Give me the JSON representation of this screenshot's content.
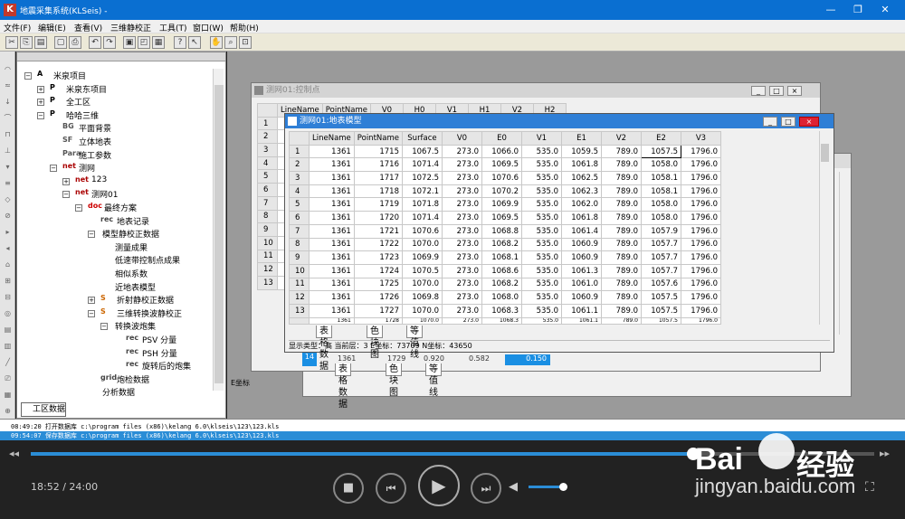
{
  "app": {
    "title": "地震采集系统(KLSeis) -"
  },
  "window_controls": {
    "min": "—",
    "max": "❐",
    "close": "✕"
  },
  "menu": [
    "文件(F)",
    "编辑(E)",
    "查看(V)",
    "三维静校正",
    "工具(T)",
    "窗口(W)",
    "帮助(H)"
  ],
  "toolbar": {
    "icons": [
      "cut-icon",
      "copy-icon",
      "paste-icon",
      "print-preview-icon",
      "print-icon",
      "undo-icon",
      "redo-icon",
      "window-icon",
      "chart-icon",
      "table-icon",
      "help-icon",
      "context-help-icon",
      "hand-icon",
      "zoom-icon",
      "fit-icon"
    ]
  },
  "tree": {
    "items": [
      {
        "label": "米泉项目",
        "icon": "A",
        "depth": 0,
        "expander": "−"
      },
      {
        "label": "米泉东项目",
        "icon": "P",
        "depth": 1,
        "expander": "+"
      },
      {
        "label": "全工区",
        "icon": "P",
        "depth": 1,
        "expander": "+"
      },
      {
        "label": "哈哈三维",
        "icon": "P",
        "depth": 1,
        "expander": "−"
      },
      {
        "label": "平面背景",
        "icon": "BG",
        "depth": 2,
        "expander": ""
      },
      {
        "label": "立体地表",
        "icon": "SF",
        "depth": 2,
        "expander": ""
      },
      {
        "label": "施工参数",
        "icon": "Para",
        "depth": 2,
        "expander": ""
      },
      {
        "label": "测网",
        "icon": "net",
        "depth": 2,
        "expander": "−"
      },
      {
        "label": "123",
        "icon": "net",
        "depth": 3,
        "expander": "+"
      },
      {
        "label": "测网01",
        "icon": "net",
        "depth": 3,
        "expander": "−"
      },
      {
        "label": "最终方案",
        "icon": "doc",
        "depth": 4,
        "expander": "−"
      },
      {
        "label": "地表记录",
        "icon": "rec",
        "depth": 5,
        "expander": ""
      },
      {
        "label": "模型静校正数据",
        "icon": "",
        "depth": 5,
        "expander": "−"
      },
      {
        "label": "测量成果",
        "icon": "",
        "depth": 6,
        "expander": ""
      },
      {
        "label": "低速带控制点成果",
        "icon": "",
        "depth": 6,
        "expander": ""
      },
      {
        "label": "相似系数",
        "icon": "",
        "depth": 6,
        "expander": ""
      },
      {
        "label": "近地表模型",
        "icon": "",
        "depth": 6,
        "expander": ""
      },
      {
        "label": "折射静校正数据",
        "icon": "S",
        "depth": 5,
        "expander": "+"
      },
      {
        "label": "三维转换波静校正",
        "icon": "S",
        "depth": 5,
        "expander": "−"
      },
      {
        "label": "转换波炮集",
        "icon": "",
        "depth": 6,
        "expander": "−"
      },
      {
        "label": "PSV 分量",
        "icon": "rec",
        "depth": 7,
        "expander": ""
      },
      {
        "label": "PSH 分量",
        "icon": "rec",
        "depth": 7,
        "expander": ""
      },
      {
        "label": "旋转后的炮集",
        "icon": "rec",
        "depth": 7,
        "expander": ""
      },
      {
        "label": "炮检数据",
        "icon": "grid",
        "depth": 5,
        "expander": ""
      },
      {
        "label": "分析数据",
        "icon": "",
        "depth": 5,
        "expander": ""
      }
    ],
    "tab": "工区数据"
  },
  "back_window": {
    "title": "测网01:控制点",
    "headers": [
      "LineName",
      "PointName",
      "V0",
      "H0",
      "V1",
      "H1",
      "V2",
      "H2"
    ],
    "rows": [
      "1",
      "2",
      "3",
      "4",
      "5",
      "6",
      "7",
      "8",
      "9",
      "10",
      "11",
      "12",
      "13"
    ],
    "partial_row": {
      "num": "14",
      "cells": [
        "1361",
        "1729",
        "0.920",
        "0.582",
        "0.150"
      ]
    },
    "tabs": [
      "表格数据",
      "色块图",
      "等值线"
    ]
  },
  "front_window": {
    "title": "测网01:地表模型",
    "headers": [
      "LineName",
      "PointName",
      "Surface",
      "V0",
      "E0",
      "V1",
      "E1",
      "V2",
      "E2",
      "V3"
    ],
    "rows": [
      [
        "1",
        "1361",
        "1715",
        "1067.5",
        "273.0",
        "1066.0",
        "535.0",
        "1059.5",
        "789.0",
        "1057.5",
        "1796.0"
      ],
      [
        "2",
        "1361",
        "1716",
        "1071.4",
        "273.0",
        "1069.5",
        "535.0",
        "1061.8",
        "789.0",
        "1058.0",
        "1796.0"
      ],
      [
        "3",
        "1361",
        "1717",
        "1072.5",
        "273.0",
        "1070.6",
        "535.0",
        "1062.5",
        "789.0",
        "1058.1",
        "1796.0"
      ],
      [
        "4",
        "1361",
        "1718",
        "1072.1",
        "273.0",
        "1070.2",
        "535.0",
        "1062.3",
        "789.0",
        "1058.1",
        "1796.0"
      ],
      [
        "5",
        "1361",
        "1719",
        "1071.8",
        "273.0",
        "1069.9",
        "535.0",
        "1062.0",
        "789.0",
        "1058.0",
        "1796.0"
      ],
      [
        "6",
        "1361",
        "1720",
        "1071.4",
        "273.0",
        "1069.5",
        "535.0",
        "1061.8",
        "789.0",
        "1058.0",
        "1796.0"
      ],
      [
        "7",
        "1361",
        "1721",
        "1070.6",
        "273.0",
        "1068.8",
        "535.0",
        "1061.4",
        "789.0",
        "1057.9",
        "1796.0"
      ],
      [
        "8",
        "1361",
        "1722",
        "1070.0",
        "273.0",
        "1068.2",
        "535.0",
        "1060.9",
        "789.0",
        "1057.7",
        "1796.0"
      ],
      [
        "9",
        "1361",
        "1723",
        "1069.9",
        "273.0",
        "1068.1",
        "535.0",
        "1060.9",
        "789.0",
        "1057.7",
        "1796.0"
      ],
      [
        "10",
        "1361",
        "1724",
        "1070.5",
        "273.0",
        "1068.6",
        "535.0",
        "1061.3",
        "789.0",
        "1057.7",
        "1796.0"
      ],
      [
        "11",
        "1361",
        "1725",
        "1070.0",
        "273.0",
        "1068.2",
        "535.0",
        "1061.0",
        "789.0",
        "1057.6",
        "1796.0"
      ],
      [
        "12",
        "1361",
        "1726",
        "1069.8",
        "273.0",
        "1068.0",
        "535.0",
        "1060.9",
        "789.0",
        "1057.5",
        "1796.0"
      ],
      [
        "13",
        "1361",
        "1727",
        "1070.0",
        "273.0",
        "1068.3",
        "535.0",
        "1061.1",
        "789.0",
        "1057.5",
        "1796.0"
      ]
    ],
    "partial_row": [
      "1361",
      "1728",
      "1070.0",
      "273.0",
      "1068.3",
      "535.0",
      "1061.1",
      "789.0",
      "1057.5",
      "1796.0"
    ],
    "tabs": [
      "表格数据",
      "色块图",
      "等值线"
    ],
    "status": "显示类型：高 当前层：3   E坐标：73709  N坐标：43650"
  },
  "third_window": {
    "status": "E坐标"
  },
  "log": {
    "line1": "08:49:20 打开数据库 c:\\program files (x86)\\kelang 6.0\\klseis\\123\\123.kls",
    "line2": "09:54:07 保存数据库 c:\\program files (x86)\\kelang 6.0\\klseis\\123\\123.kls"
  },
  "player": {
    "time": "18:52 / 24:00",
    "progress": 0.785,
    "volume": 0.75
  },
  "watermark": {
    "logo": "Bai",
    "logo2": "经验",
    "url": "jingyan.baidu.com"
  }
}
